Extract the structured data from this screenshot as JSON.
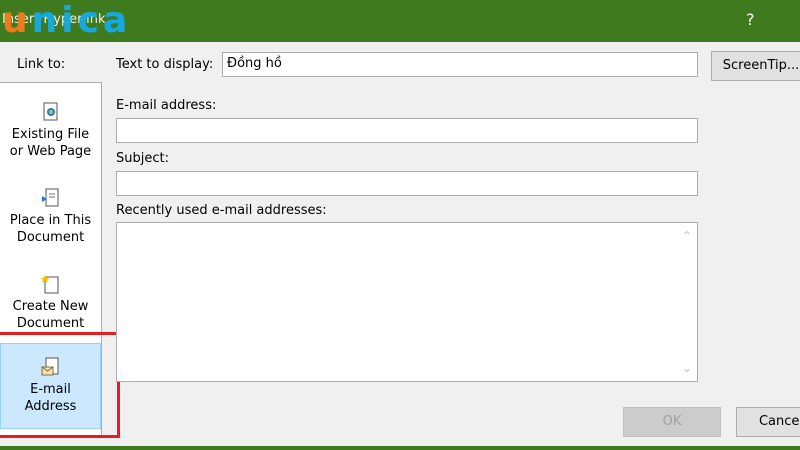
{
  "window": {
    "title": "Insert Hyperlink",
    "help": "?",
    "logo_first": "u",
    "logo_rest": "nica"
  },
  "left": {
    "label": "Link to:",
    "items": [
      {
        "line1": "Existing File",
        "line2": "or Web Page",
        "icon": "file-web-icon"
      },
      {
        "line1": "Place in This",
        "line2": "Document",
        "icon": "document-place-icon"
      },
      {
        "line1": "Create New",
        "line2": "Document",
        "icon": "new-document-icon"
      },
      {
        "line1": "E-mail",
        "line2": "Address",
        "icon": "email-icon",
        "selected": true
      }
    ]
  },
  "form": {
    "text_display_label": "Text to display:",
    "text_display_value": "Đồng hồ",
    "screentip_label": "ScreenTip...",
    "email_label": "E-mail address:",
    "email_value": "",
    "subject_label": "Subject:",
    "subject_value": "",
    "recent_label": "Recently used e-mail addresses:"
  },
  "buttons": {
    "ok": "OK",
    "cancel": "Cancel"
  },
  "colors": {
    "titlebar": "#3f7a1f",
    "selected_item": "#cce8ff",
    "highlight": "#e41c23"
  }
}
